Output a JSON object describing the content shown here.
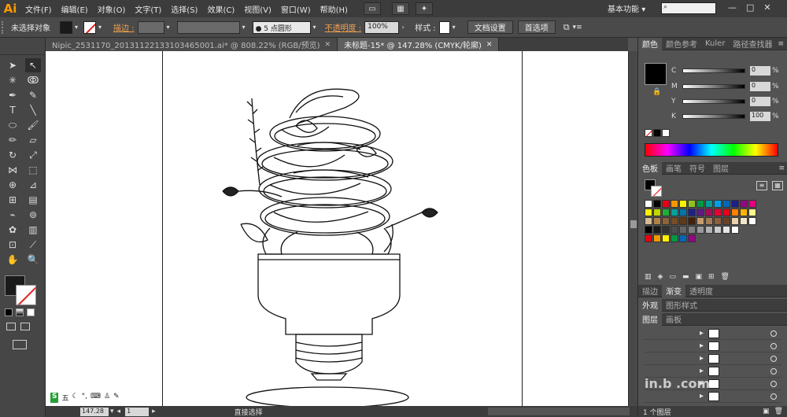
{
  "app": {
    "logo": "Ai"
  },
  "menu": [
    "文件(F)",
    "编辑(E)",
    "对象(O)",
    "文字(T)",
    "选择(S)",
    "效果(C)",
    "视图(V)",
    "窗口(W)",
    "帮助(H)"
  ],
  "workspace": {
    "label": "基本功能",
    "arrow": "▾"
  },
  "window_buttons": [
    "—",
    "□",
    "✕"
  ],
  "control": {
    "no_selection": "未选择对象",
    "stroke_label": "描边 :",
    "brush_value": "5 点圆形",
    "opacity_label": "不透明度 :",
    "opacity_value": "100%",
    "style_label": "样式 :",
    "doc_settings": "文档设置",
    "preferences": "首选项"
  },
  "tabs": [
    {
      "label": "Nipic_2531170_20131122133103465001.ai* @ 808.22% (RGB/预览)",
      "close": "✕",
      "active": false
    },
    {
      "label": "未标题-15* @ 147.28% (CMYK/轮廓)",
      "close": "✕",
      "active": true
    }
  ],
  "tools": [
    "selection-tool",
    "direct-selection-tool",
    "magic-wand-tool",
    "lasso-tool",
    "pen-tool",
    "curvature-tool",
    "type-tool",
    "line-tool",
    "ellipse-tool",
    "paintbrush-tool",
    "pencil-tool",
    "eraser-tool",
    "rotate-tool",
    "scale-tool",
    "width-tool",
    "free-transform-tool",
    "shape-builder-tool",
    "perspective-tool",
    "mesh-tool",
    "gradient-tool",
    "eyedropper-tool",
    "blend-tool",
    "symbol-sprayer-tool",
    "graph-tool",
    "artboard-tool",
    "slice-tool",
    "hand-tool",
    "zoom-tool"
  ],
  "status": {
    "zoom": "147.28",
    "page": "1",
    "tool_name": "直接选择",
    "ime": "五"
  },
  "color_panel": {
    "tabs": [
      "颜色",
      "颜色参考",
      "Kuler",
      "路径查找器"
    ],
    "channels": [
      {
        "label": "C",
        "value": "0",
        "unit": "%"
      },
      {
        "label": "M",
        "value": "0",
        "unit": "%"
      },
      {
        "label": "Y",
        "value": "0",
        "unit": "%"
      },
      {
        "label": "K",
        "value": "100",
        "unit": "%"
      }
    ]
  },
  "swatch_panel": {
    "tabs": [
      "色板",
      "画笔",
      "符号",
      "图层"
    ],
    "rows": [
      [
        "#ffffff",
        "#000000",
        "#e60012",
        "#f39800",
        "#fff100",
        "#8fc31f",
        "#009944",
        "#009e96",
        "#00a0e9",
        "#0068b7",
        "#1d2088",
        "#920783",
        "#e4007f"
      ],
      [
        "#fff100",
        "#c2d600",
        "#22ac38",
        "#00a29a",
        "#0075a9",
        "#1d2088",
        "#5f1985",
        "#a40b5d",
        "#e60033",
        "#e2041b",
        "#ff7f00",
        "#ffb600",
        "#fff68f"
      ],
      [
        "#d5bb94",
        "#b28146",
        "#8c6239",
        "#754c24",
        "#603813",
        "#42210b",
        "#c69c6d",
        "#a67c52",
        "#8b5e3c",
        "#6b4226",
        "#e8d0a9",
        "#f2e6c9",
        "#ffffff"
      ],
      [
        "#000000",
        "#1a1a1a",
        "#333333",
        "#4d4d4d",
        "#666666",
        "#808080",
        "#999999",
        "#b3b3b3",
        "#cccccc",
        "#e6e6e6",
        "#ffffff"
      ],
      [
        "#e60012",
        "#f39800",
        "#fff100",
        "#009944",
        "#0068b7",
        "#920783"
      ]
    ]
  },
  "stroke_panel": {
    "tabs": [
      "描边",
      "渐变",
      "透明度"
    ]
  },
  "appearance_panel": {
    "tabs": [
      "外观",
      "图形样式"
    ]
  },
  "layers_panel": {
    "tabs": [
      "图层",
      "画板"
    ],
    "footer": "1 个图层"
  },
  "watermark": {
    "text": "in.b   .com"
  }
}
